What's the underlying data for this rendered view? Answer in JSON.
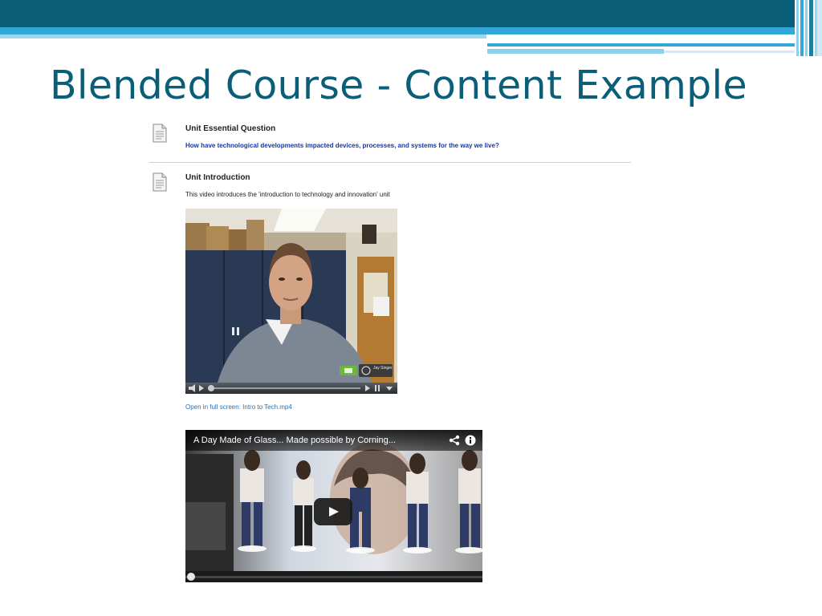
{
  "slide": {
    "title": "Blended Course - Content Example"
  },
  "items": [
    {
      "icon": "document-icon",
      "title": "Unit Essential Question",
      "link": "How have technological developments impacted devices, processes, and systems for the way we live?"
    },
    {
      "icon": "document-icon",
      "title": "Unit Introduction",
      "description": "This video introduces the 'introduction to technology and innovation' unit"
    }
  ],
  "video1": {
    "overlay_caption": "Jay Singer",
    "fullscreen_link": "Open in full screen:  Intro to Tech.mp4"
  },
  "video2": {
    "title": "A Day Made of Glass... Made possible by Corning...",
    "share_icon": "share-icon",
    "info_icon": "info-icon",
    "play_icon": "play-icon"
  },
  "colors": {
    "title": "#0b5e78",
    "band_dark": "#0b5e78",
    "band_light": "#31a8d8",
    "link": "#1a35a8"
  }
}
